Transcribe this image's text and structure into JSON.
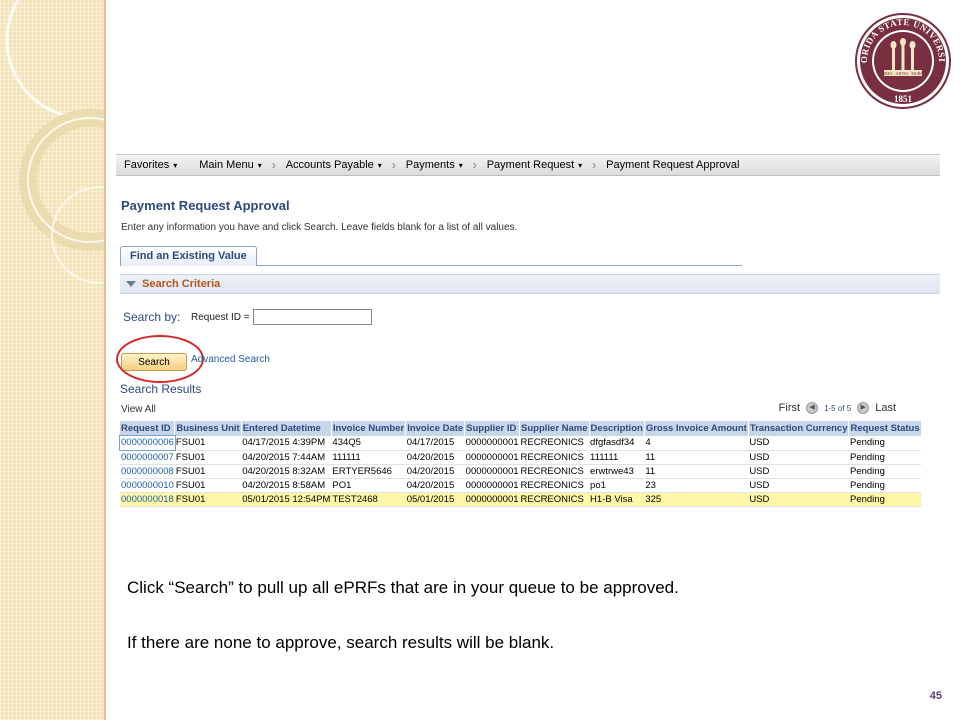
{
  "seal": {
    "outer_text": "FLORIDA STATE UNIVERSITY",
    "year": "1851",
    "banner_words": [
      "VIRES",
      "ARTES",
      "MORES"
    ]
  },
  "nav": {
    "items": [
      {
        "label": "Favorites",
        "has_caret": true
      },
      {
        "label": "Main Menu",
        "has_caret": true
      },
      {
        "label": "Accounts Payable",
        "has_caret": true
      },
      {
        "label": "Payments",
        "has_caret": true
      },
      {
        "label": "Payment Request",
        "has_caret": true
      },
      {
        "label": "Payment Request Approval",
        "has_caret": false
      }
    ],
    "separator": "›",
    "caret": "▾"
  },
  "page": {
    "title": "Payment Request Approval",
    "instructions": "Enter any information you have and click Search. Leave fields blank for a list of all values.",
    "tab_label": "Find an Existing Value",
    "criteria_label": "Search Criteria",
    "search_by_label": "Search by:",
    "field_label": "Request ID =",
    "field_value": "",
    "search_button": "Search",
    "advanced_search": "Advanced Search",
    "results_title": "Search Results"
  },
  "results": {
    "view_all": "View All",
    "first": "First",
    "range": "1-5 of 5",
    "last": "Last",
    "columns": [
      "Request ID",
      "Business Unit",
      "Entered Datetime",
      "Invoice Number",
      "Invoice Date",
      "Supplier ID",
      "Supplier Name",
      "Description",
      "Gross Invoice Amount",
      "Transaction Currency",
      "Request Status"
    ],
    "rows": [
      [
        "0000000006",
        "FSU01",
        "04/17/2015  4:39PM",
        "434Q5",
        "04/17/2015",
        "0000000001",
        "RECREONICS",
        "dfgfasdf34",
        "4",
        "USD",
        "Pending"
      ],
      [
        "0000000007",
        "FSU01",
        "04/20/2015  7:44AM",
        "111111",
        "04/20/2015",
        "0000000001",
        "RECREONICS",
        "111111",
        "11",
        "USD",
        "Pending"
      ],
      [
        "0000000008",
        "FSU01",
        "04/20/2015  8:32AM",
        "ERTYER5646",
        "04/20/2015",
        "0000000001",
        "RECREONICS",
        "erwtrwe43",
        "11",
        "USD",
        "Pending"
      ],
      [
        "0000000010",
        "FSU01",
        "04/20/2015  8:58AM",
        "PO1",
        "04/20/2015",
        "0000000001",
        "RECREONICS",
        "po1",
        "23",
        "USD",
        "Pending"
      ],
      [
        "0000000018",
        "FSU01",
        "05/01/2015 12:54PM",
        "TEST2468",
        "05/01/2015",
        "0000000001",
        "RECREONICS",
        "H1-B Visa",
        "325",
        "USD",
        "Pending"
      ]
    ],
    "highlight_row_index": 4
  },
  "caption": {
    "line1": "Click “Search” to pull up all ePRFs that are in your queue to be approved.",
    "line2": "If there are none to approve, search results will be blank."
  },
  "slide_number": "45",
  "colors": {
    "accent_title": "#2c4a7e",
    "link": "#1d5fa8",
    "criteria": "#b5551b",
    "highlight_row": "#fff7a8",
    "seal_garnet": "#782f40",
    "circle": "#d32a2a"
  }
}
